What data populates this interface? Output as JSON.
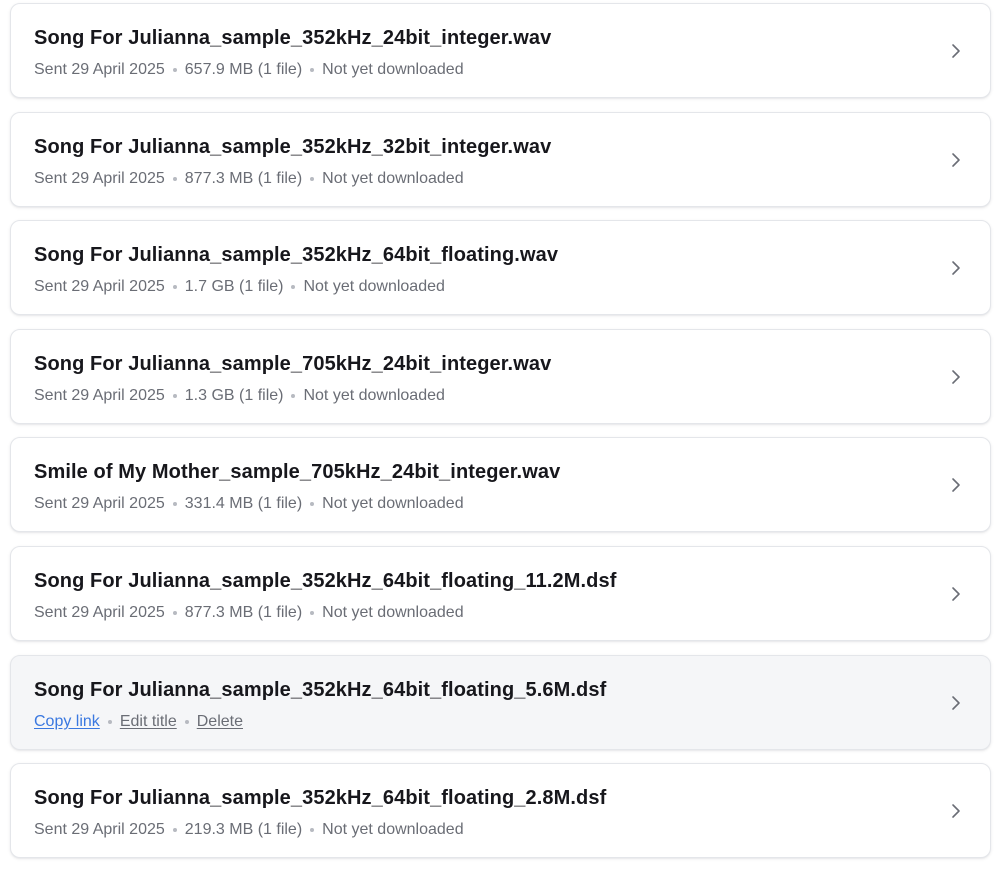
{
  "transfers": [
    {
      "title": "Song For Julianna_sample_352kHz_24bit_integer.wav",
      "sent": "Sent 29 April 2025",
      "size": "657.9 MB (1 file)",
      "status": "Not yet downloaded"
    },
    {
      "title": "Song For Julianna_sample_352kHz_32bit_integer.wav",
      "sent": "Sent 29 April 2025",
      "size": "877.3 MB (1 file)",
      "status": "Not yet downloaded"
    },
    {
      "title": "Song For Julianna_sample_352kHz_64bit_floating.wav",
      "sent": "Sent 29 April 2025",
      "size": "1.7 GB (1 file)",
      "status": "Not yet downloaded"
    },
    {
      "title": "Song For Julianna_sample_705kHz_24bit_integer.wav",
      "sent": "Sent 29 April 2025",
      "size": "1.3 GB (1 file)",
      "status": "Not yet downloaded"
    },
    {
      "title": "Smile of My Mother_sample_705kHz_24bit_integer.wav",
      "sent": "Sent 29 April 2025",
      "size": "331.4 MB (1 file)",
      "status": "Not yet downloaded"
    },
    {
      "title": "Song For Julianna_sample_352kHz_64bit_floating_11.2M.dsf",
      "sent": "Sent 29 April 2025",
      "size": "877.3 MB (1 file)",
      "status": "Not yet downloaded"
    },
    {
      "title": "Song For Julianna_sample_352kHz_64bit_floating_5.6M.dsf",
      "actions": {
        "copy_link": "Copy link",
        "edit_title": "Edit title",
        "delete": "Delete"
      }
    },
    {
      "title": "Song For Julianna_sample_352kHz_64bit_floating_2.8M.dsf",
      "sent": "Sent 29 April 2025",
      "size": "219.3 MB (1 file)",
      "status": "Not yet downloaded"
    }
  ],
  "icons": {
    "row_chevron": "chevron-right-icon"
  },
  "colors": {
    "title": "#17171c",
    "meta": "#6a6d75",
    "link_accent": "#3a78e0",
    "hover_background": "#f5f6f8"
  }
}
